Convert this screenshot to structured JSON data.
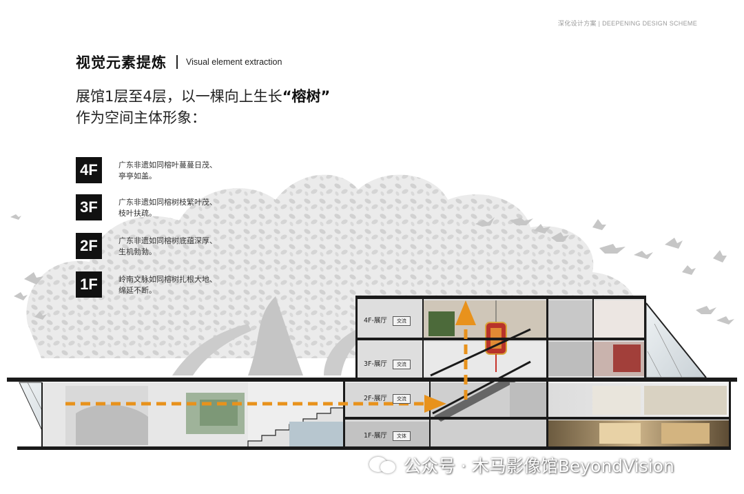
{
  "header": {
    "tag": "深化设计方案 | DEEPENING DESIGN SCHEME"
  },
  "title": {
    "cn": "视觉元素提炼",
    "en": "Visual element extraction"
  },
  "headline": {
    "line1_prefix": "展馆1层至4层，以一棵向上生长",
    "line1_highlight": "“榕树”",
    "line2": "作为空间主体形象："
  },
  "floors": [
    {
      "badge": "4F",
      "line1": "广东非遗如同榕叶蔓蔓日茂、",
      "line2": "亭亭如盖。"
    },
    {
      "badge": "3F",
      "line1": "广东非遗如同榕树枝繁叶茂、",
      "line2": "枝叶扶疏。"
    },
    {
      "badge": "2F",
      "line1": "广东非遗如同榕树底蕴深厚、",
      "line2": "生机勃勃。"
    },
    {
      "badge": "1F",
      "line1": "岭南文脉如同榕树扎根大地、",
      "line2": "绵延不断。"
    }
  ],
  "section": {
    "labels": [
      {
        "floor": "4F-展厅",
        "tag": "交流"
      },
      {
        "floor": "3F-展厅",
        "tag": "交流"
      },
      {
        "floor": "2F-展厅",
        "tag": "交流"
      },
      {
        "floor": "1F-展厅",
        "tag": "文体"
      }
    ]
  },
  "watermark": {
    "text": "公众号 · 木马影像馆BeyondVision"
  },
  "colors": {
    "arrow": "#e8921c",
    "tree": "#cfcfcf",
    "structure": "#1a1a1a",
    "badge": "#111111"
  }
}
